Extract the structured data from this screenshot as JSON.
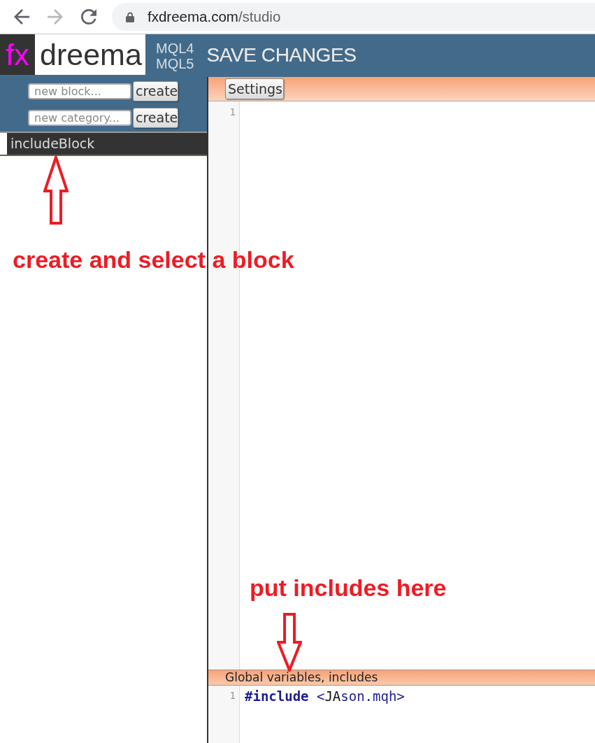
{
  "browser": {
    "address": {
      "host": "fxdreema.com",
      "path": "/studio"
    }
  },
  "header": {
    "logo": {
      "prefix": "fx",
      "name": "dreema"
    },
    "languages": [
      "MQL4",
      "MQL5"
    ],
    "save_button": "SAVE CHANGES"
  },
  "sidebar": {
    "forms": [
      {
        "placeholder": "new block...",
        "button": "create"
      },
      {
        "placeholder": "new category...",
        "button": "create"
      }
    ],
    "block_title": "includeBlock"
  },
  "editor": {
    "toolbar_button": "Settings",
    "lines": [
      {
        "number": "1"
      }
    ]
  },
  "globals_editor": {
    "title": "Global variables, includes",
    "lines": [
      {
        "number": "1",
        "tokens": [
          {
            "kind": "keyword",
            "text": "#include"
          },
          {
            "kind": "string",
            "text": " <"
          },
          {
            "kind": "plain",
            "text": "JA"
          },
          {
            "kind": "string",
            "text": "son.mqh>"
          }
        ]
      }
    ]
  },
  "annotations": [
    {
      "kind": "arrow_up",
      "text": "create and select a block"
    },
    {
      "kind": "arrow_down",
      "text": "put includes here"
    }
  ]
}
